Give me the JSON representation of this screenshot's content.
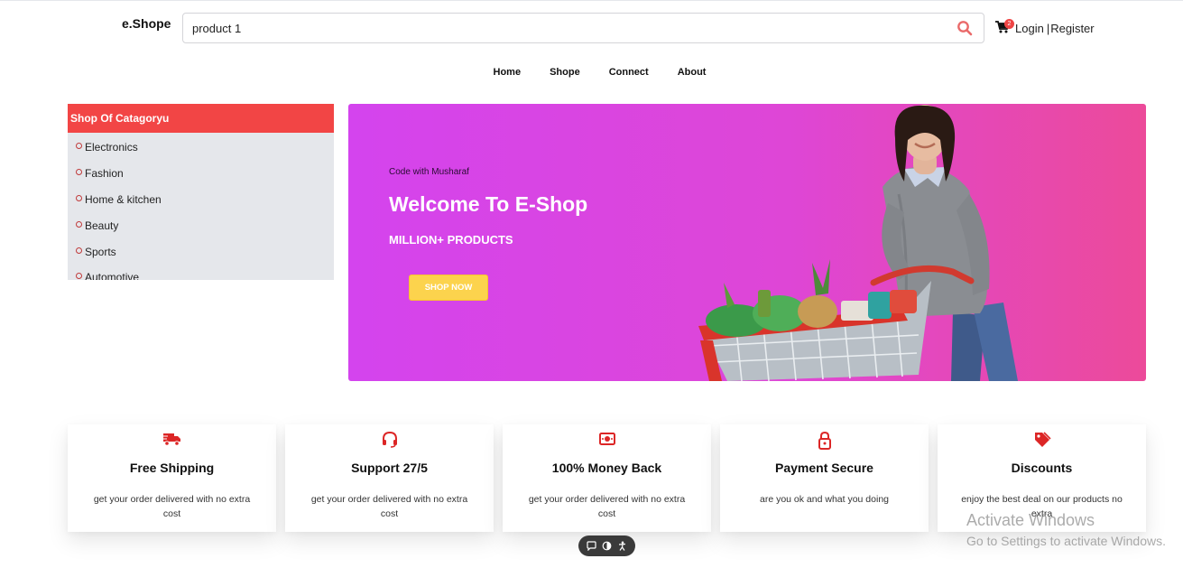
{
  "header": {
    "logo": "e.Shope",
    "search": {
      "value": "product 1",
      "icon": "search-icon"
    },
    "cart": {
      "icon": "cart-icon",
      "count": "2"
    },
    "login_label": "Login",
    "separator": "|",
    "register_label": "Register"
  },
  "nav": {
    "items": [
      "Home",
      "Shope",
      "Connect",
      "About"
    ]
  },
  "sidebar": {
    "title": "Shop Of Catagoryu",
    "items": [
      "Electronics",
      "Fashion",
      "Home & kitchen",
      "Beauty",
      "Sports",
      "Automotive"
    ]
  },
  "hero": {
    "tag": "Code with Musharaf",
    "title": "Welcome To E-Shop",
    "subtitle": "MILLION+ PRODUCTS",
    "button_label": "SHOP NOW"
  },
  "features": [
    {
      "icon": "truck-icon",
      "title": "Free Shipping",
      "text": "get your order delivered with no extra cost"
    },
    {
      "icon": "headset-icon",
      "title": "Support 27/5",
      "text": "get your order delivered with no extra cost"
    },
    {
      "icon": "money-icon",
      "title": "100% Money Back",
      "text": "get your order delivered with no extra cost"
    },
    {
      "icon": "lock-icon",
      "title": "Payment Secure",
      "text": "are you ok and what you doing"
    },
    {
      "icon": "tag-icon",
      "title": "Discounts",
      "text": "enjoy the best deal on our products no extra"
    }
  ],
  "watermark": {
    "line1": "Activate Windows",
    "line2": "Go to Settings to activate Windows."
  },
  "colors": {
    "accent": "#f24545",
    "hero_start": "#d444ee",
    "hero_end": "#ec4a9a",
    "button": "#fcd34d"
  }
}
